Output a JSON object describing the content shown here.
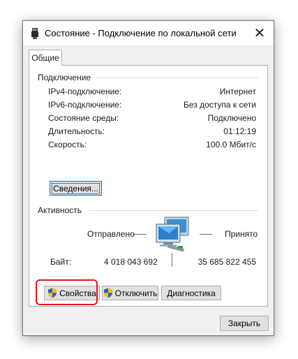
{
  "window": {
    "title": "Состояние - Подключение по локальной сети",
    "close_glyph": "✕"
  },
  "tabs": [
    {
      "label": "Общие",
      "active": true
    }
  ],
  "connection": {
    "header": "Подключение",
    "rows": [
      {
        "label": "IPv4-подключение:",
        "value": "Интернет"
      },
      {
        "label": "IPv6-подключение:",
        "value": "Без доступа к сети"
      },
      {
        "label": "Состояние среды:",
        "value": "Подключено"
      },
      {
        "label": "Длительность:",
        "value": "01:12:19"
      },
      {
        "label": "Скорость:",
        "value": "100.0 Мбит/с"
      }
    ],
    "details_button": "Сведения..."
  },
  "activity": {
    "header": "Активность",
    "sent_label": "Отправлено",
    "received_label": "Принято",
    "bytes_label": "Байт:",
    "bytes_sent": "4 018 043 692",
    "bytes_received": "35 685 822 455"
  },
  "actions": {
    "properties": "Свойства",
    "disable": "Отключить",
    "diagnose": "Диагностика"
  },
  "footer": {
    "close": "Закрыть"
  },
  "icons": {
    "title": "network-adapter-icon",
    "activity": "network-computers-icon",
    "shield": "uac-shield-icon"
  },
  "colors": {
    "highlight": "#e01919",
    "focus_border": "#0078d7"
  }
}
